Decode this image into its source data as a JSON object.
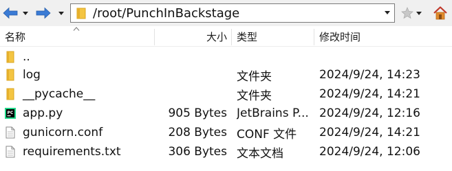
{
  "toolbar": {
    "path": "/root/PunchInBackstage",
    "icons": {
      "back": "back-arrow-icon",
      "forward": "forward-arrow-icon",
      "favorite": "star-icon",
      "home": "home-icon"
    }
  },
  "columns": {
    "name": "名称",
    "size": "大小",
    "type": "类型",
    "modified": "修改时间"
  },
  "files": [
    {
      "name": "..",
      "size": "",
      "type": "",
      "modified": "",
      "icon": "folder-icon"
    },
    {
      "name": "log",
      "size": "",
      "type": "文件夹",
      "modified": "2024/9/24, 14:23",
      "icon": "folder-icon"
    },
    {
      "name": "__pycache__",
      "size": "",
      "type": "文件夹",
      "modified": "2024/9/24, 14:21",
      "icon": "folder-icon"
    },
    {
      "name": "app.py",
      "size": "905 Bytes",
      "type": "JetBrains P...",
      "modified": "2024/9/24, 12:16",
      "icon": "pycharm-file-icon"
    },
    {
      "name": "gunicorn.conf",
      "size": "208 Bytes",
      "type": "CONF 文件",
      "modified": "2024/9/24, 14:21",
      "icon": "document-file-icon"
    },
    {
      "name": "requirements.txt",
      "size": "306 Bytes",
      "type": "文本文档",
      "modified": "2024/9/24, 12:06",
      "icon": "document-file-icon"
    }
  ],
  "colors": {
    "arrow_blue": "#3a7bd5",
    "folder_yellow": "#f4c542",
    "home_orange": "#e08a2c"
  }
}
